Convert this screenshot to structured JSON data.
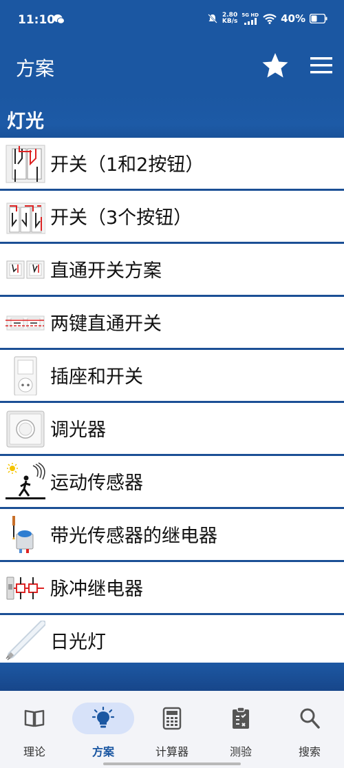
{
  "status_bar": {
    "time": "11:10",
    "speed_value": "2.80",
    "speed_unit": "KB/s",
    "network": "5G HD",
    "battery": "40%"
  },
  "app_bar": {
    "title": "方案"
  },
  "section": {
    "title": "灯光"
  },
  "items": [
    {
      "label": "开关（1和2按钮）",
      "icon": "switch-wiring-icon"
    },
    {
      "label": "开关（3个按钮）",
      "icon": "three-button-switch-icon"
    },
    {
      "label": "直通开关方案",
      "icon": "passthrough-switch-icon"
    },
    {
      "label": "两键直通开关",
      "icon": "two-key-switch-icon"
    },
    {
      "label": "插座和开关",
      "icon": "socket-switch-icon"
    },
    {
      "label": "调光器",
      "icon": "dimmer-icon"
    },
    {
      "label": "运动传感器",
      "icon": "motion-sensor-icon"
    },
    {
      "label": "带光传感器的继电器",
      "icon": "light-sensor-relay-icon"
    },
    {
      "label": "脉冲继电器",
      "icon": "impulse-relay-icon"
    },
    {
      "label": "日光灯",
      "icon": "fluorescent-lamp-icon"
    }
  ],
  "bottom_nav": [
    {
      "label": "理论",
      "icon": "book-icon",
      "active": false
    },
    {
      "label": "方案",
      "icon": "lightbulb-icon",
      "active": true
    },
    {
      "label": "计算器",
      "icon": "calculator-icon",
      "active": false
    },
    {
      "label": "测验",
      "icon": "clipboard-icon",
      "active": false
    },
    {
      "label": "搜索",
      "icon": "search-icon",
      "active": false
    }
  ],
  "colors": {
    "primary": "#1b57a2",
    "divider": "#1b4f95",
    "nav_active_pill": "#d7e2f9"
  }
}
